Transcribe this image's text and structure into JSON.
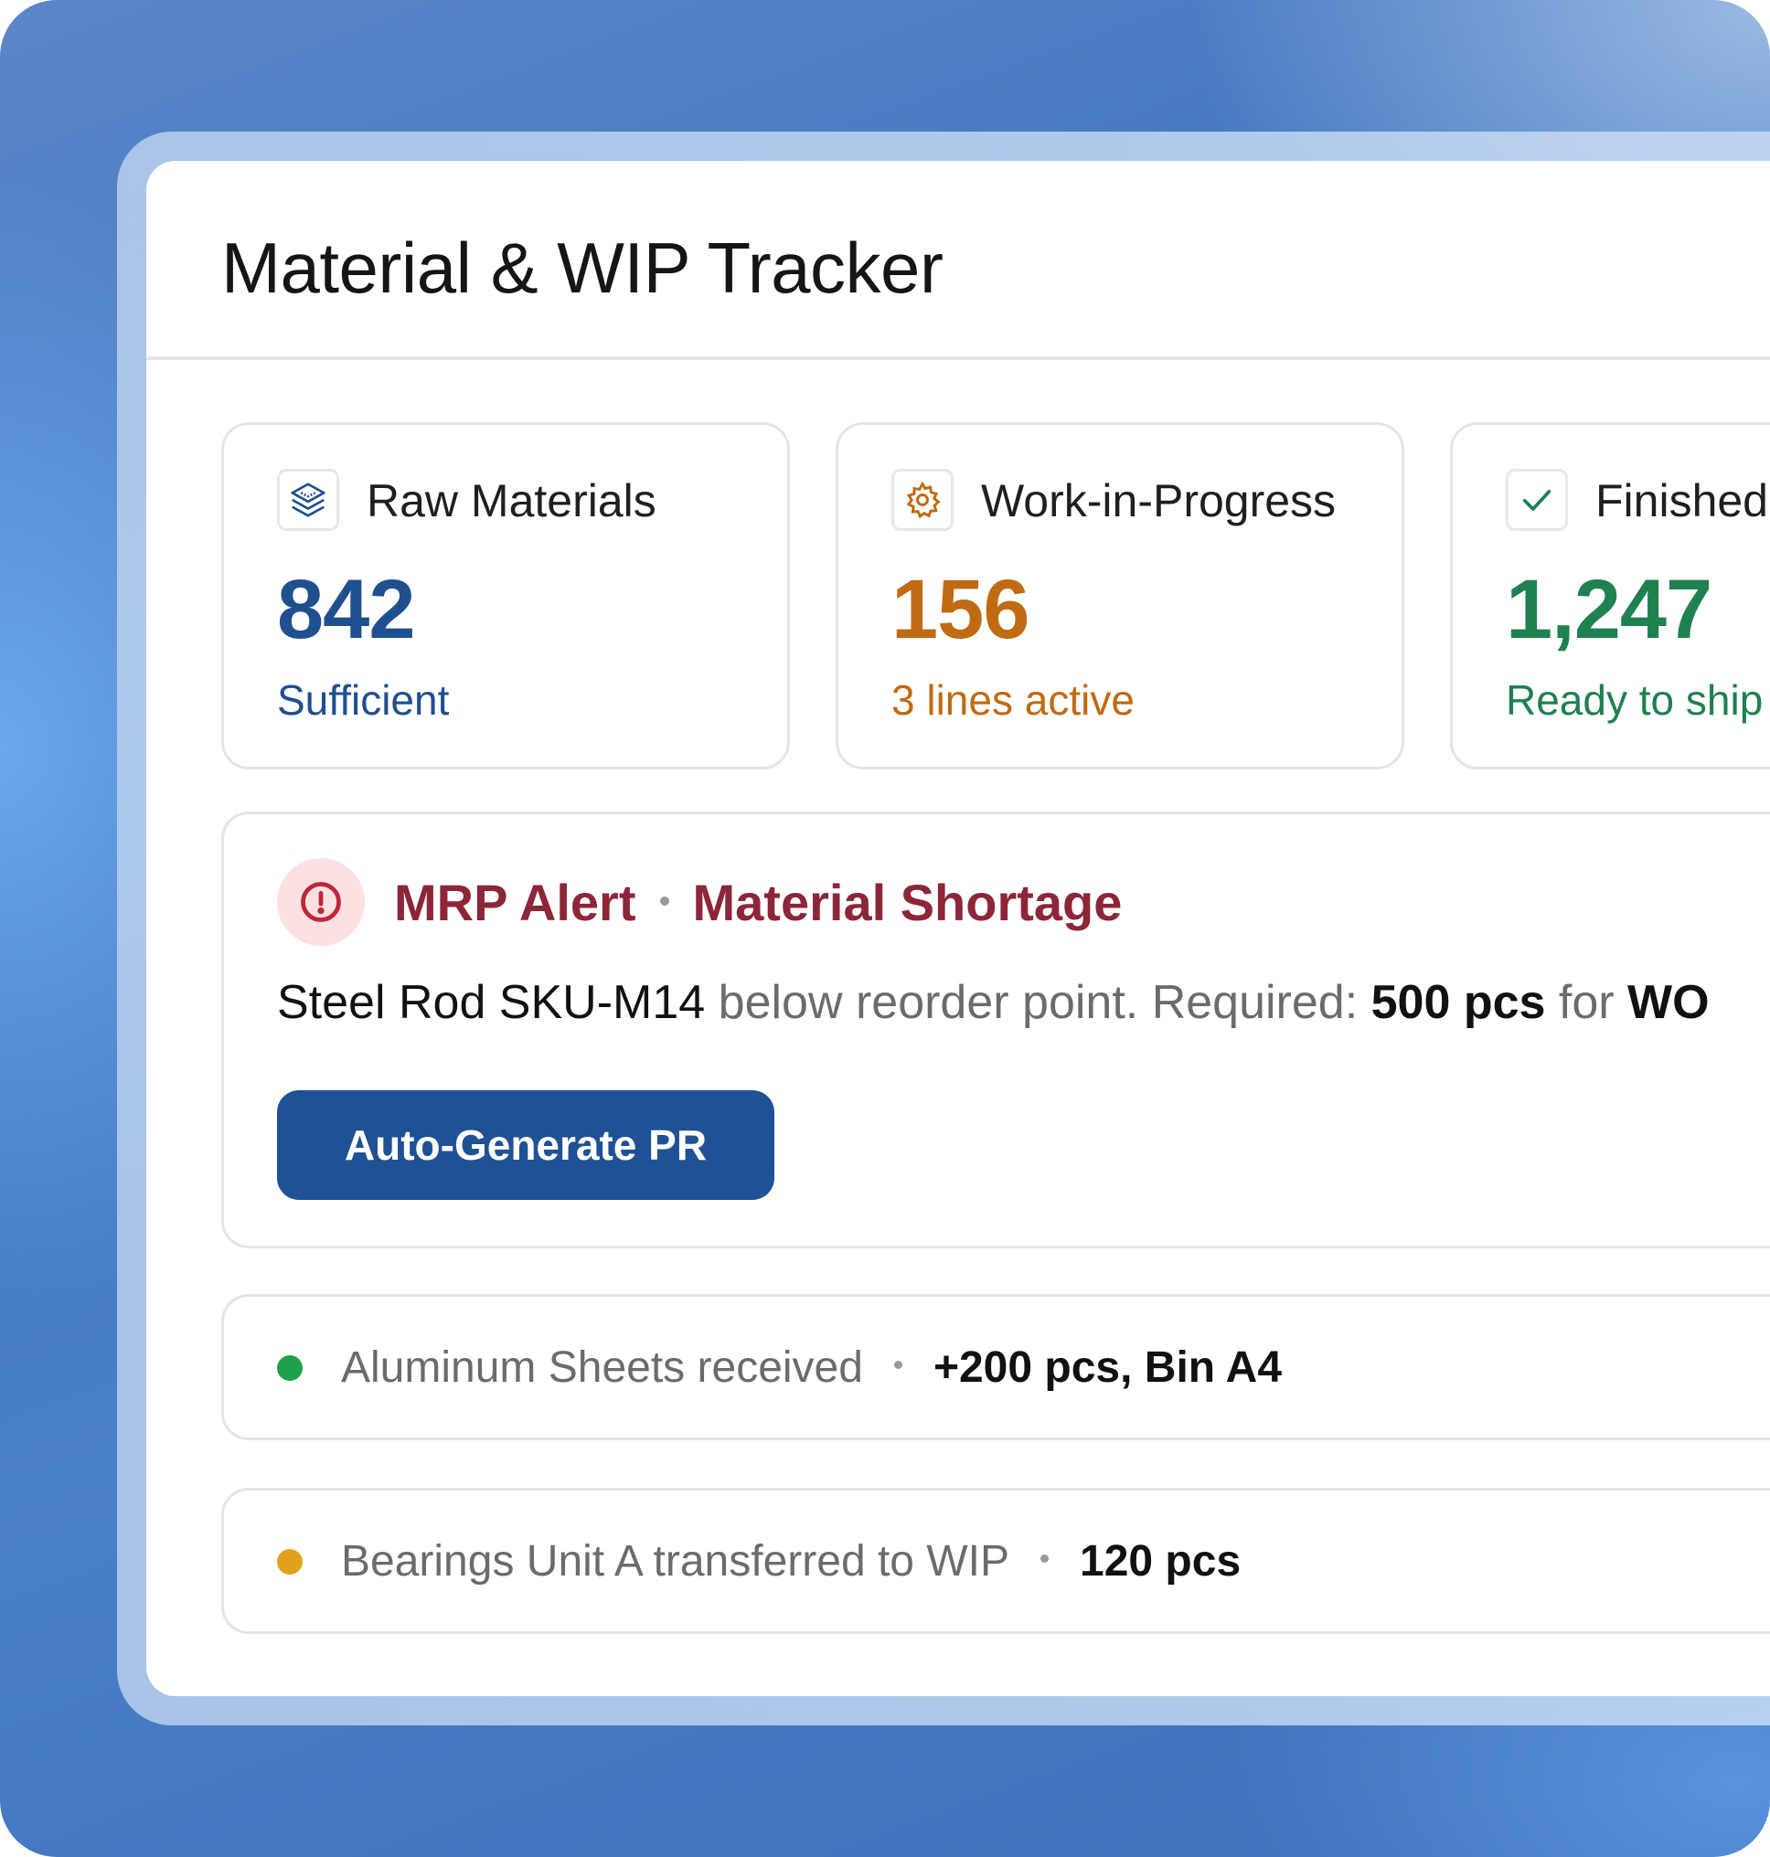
{
  "header": {
    "title": "Material & WIP Tracker"
  },
  "stats": [
    {
      "label": "Raw Materials",
      "value": "842",
      "sub": "Sufficient",
      "icon": "layers-icon",
      "color": "#1f4f8f"
    },
    {
      "label": "Work-in-Progress",
      "value": "156",
      "sub": "3 lines active",
      "icon": "gear-icon",
      "color": "#c06a12"
    },
    {
      "label": "Finished",
      "value": "1,247",
      "sub": "Ready to ship",
      "icon": "check-icon",
      "color": "#1f8050"
    }
  ],
  "alert": {
    "icon": "alert-circle-icon",
    "title": "MRP Alert",
    "subtitle": "Material Shortage",
    "message": {
      "item": "Steel Rod SKU-M14",
      "text": " below reorder point. Required: ",
      "qty": "500 pcs",
      "for": " for ",
      "order": "WO"
    },
    "button_label": "Auto-Generate PR",
    "color": "#8c2638"
  },
  "activity": [
    {
      "text": "Aluminum Sheets received",
      "detail": "+200 pcs, Bin A4",
      "dot_color": "#1ea04a"
    },
    {
      "text": "Bearings Unit A transferred to WIP",
      "detail": "120 pcs",
      "dot_color": "#e0a21c"
    }
  ]
}
